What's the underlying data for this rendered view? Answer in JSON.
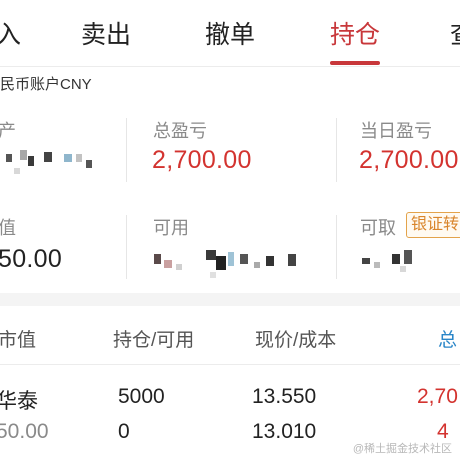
{
  "tabs": [
    {
      "label": "入",
      "active": false
    },
    {
      "label": "卖出",
      "active": false
    },
    {
      "label": "撤单",
      "active": false
    },
    {
      "label": "持仓",
      "active": true
    },
    {
      "label": "查",
      "active": false
    }
  ],
  "account": {
    "label": "民币账户CNY"
  },
  "summary": {
    "row1": {
      "col1_label": "产",
      "col2_label": "总盈亏",
      "col2_value": "2,700.00",
      "col3_label": "当日盈亏",
      "col3_value": "2,700.00"
    },
    "row2": {
      "col1_label": "值",
      "col1_value": "50.00",
      "col2_label": "可用",
      "col3_label": "可取",
      "transfer_badge": "银证转"
    }
  },
  "table": {
    "headers": [
      "市值",
      "持仓/可用",
      "现价/成本",
      "总"
    ],
    "rows": [
      {
        "name": "华泰",
        "market_value": "50.00",
        "position": "5000",
        "available": "0",
        "price": "13.550",
        "cost": "13.010",
        "pnl_top": "2,70",
        "pnl_bottom": "4"
      }
    ]
  },
  "watermark": "@稀土掘金技术社区",
  "colors": {
    "accent": "#c8373a",
    "profit": "#d3332f",
    "link": "#2a86c8",
    "badge": "#d9852b"
  }
}
